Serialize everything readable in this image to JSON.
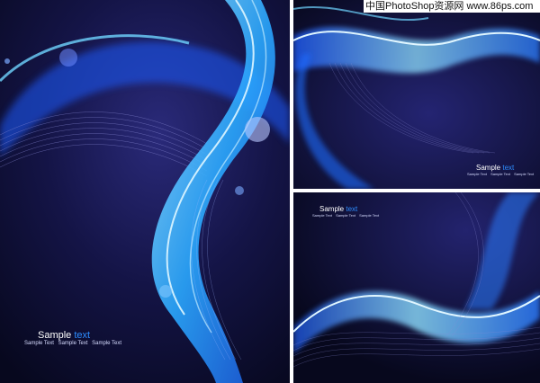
{
  "watermark": "中国PhotoShop资源网 www.86ps.com",
  "left": {
    "title_main": "Sample",
    "title_accent": "text",
    "sub": [
      "Sample Text",
      "Sample Text",
      "Sample Text"
    ]
  },
  "right_top": {
    "title_main": "Sample",
    "title_accent": "text",
    "sub": [
      "Sample Text",
      "Sample Text",
      "Sample Text"
    ]
  },
  "right_bottom": {
    "title_main": "Sample",
    "title_accent": "text",
    "sub": [
      "Sample Text",
      "Sample Text",
      "Sample Text"
    ]
  },
  "colors": {
    "background": "#0b0c2a",
    "wave_bright": "#4fc3ff",
    "wave_glow": "#2a6dff",
    "accent_text": "#2d8dff"
  }
}
